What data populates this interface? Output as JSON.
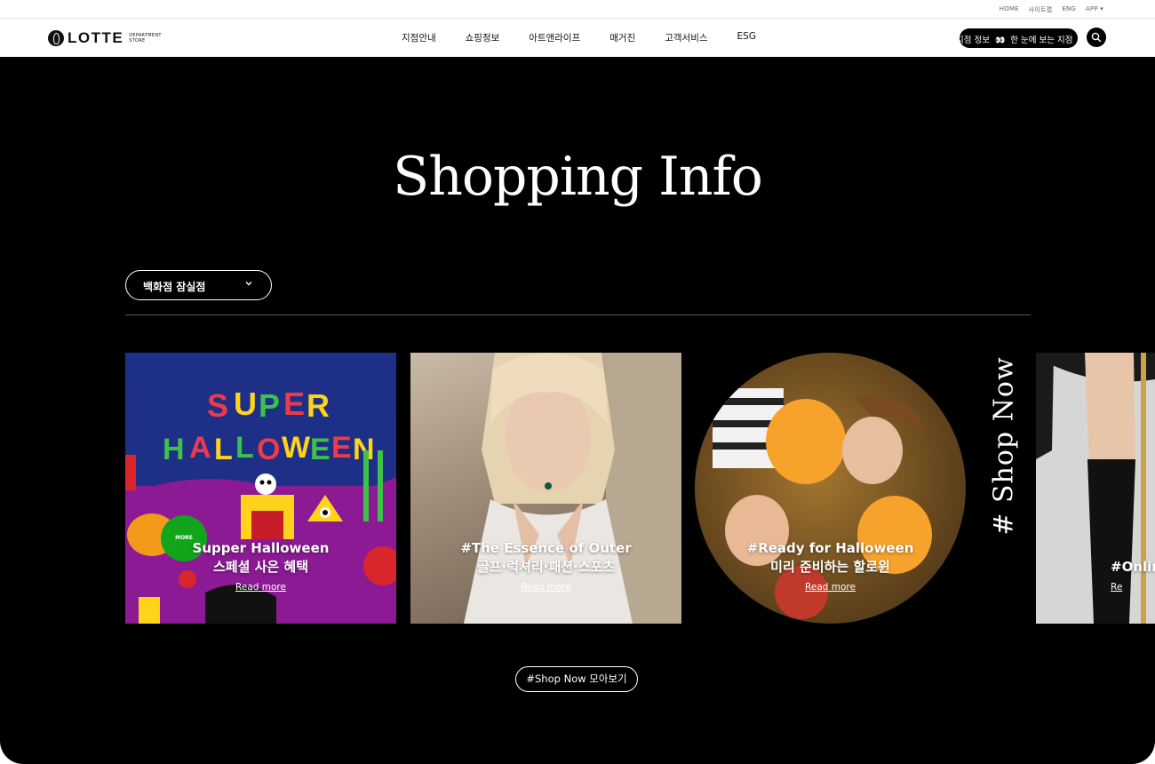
{
  "utility": [
    "HOME",
    "사이트맵",
    "ENG",
    "APP ▾"
  ],
  "brand": {
    "name": "LOTTE",
    "sub1": "DEPARTMENT",
    "sub2": "STORE"
  },
  "nav": [
    "지점안내",
    "쇼핑정보",
    "아트앤라이프",
    "매거진",
    "고객서비스",
    "ESG"
  ],
  "ticker": {
    "text_a": "지점 정보",
    "eyes": "👀",
    "text_b": "한 눈에 보는 지점"
  },
  "search_icon": "search-icon",
  "page": {
    "title": "Shopping Info"
  },
  "branch_select": {
    "value": "백화점  잠실점"
  },
  "cards": [
    {
      "title": "Supper Halloween",
      "sub": "스페셜 사은 혜택",
      "more": "Read more",
      "badge": "MORE"
    },
    {
      "title": "#The Essence of Outer",
      "sub": "골프·럭셔리·패션·스포츠",
      "more": "Read more"
    },
    {
      "title": "#Ready for Halloween",
      "sub": "미리 준비하는 할로윈",
      "more": "Read more"
    },
    {
      "title": "#Onlin",
      "more": "Re"
    }
  ],
  "shop_now_vertical": "# Shop Now",
  "collect_button": "#Shop Now 모아보기",
  "colors": {
    "background": "#000000",
    "badge": "#12a51c"
  }
}
